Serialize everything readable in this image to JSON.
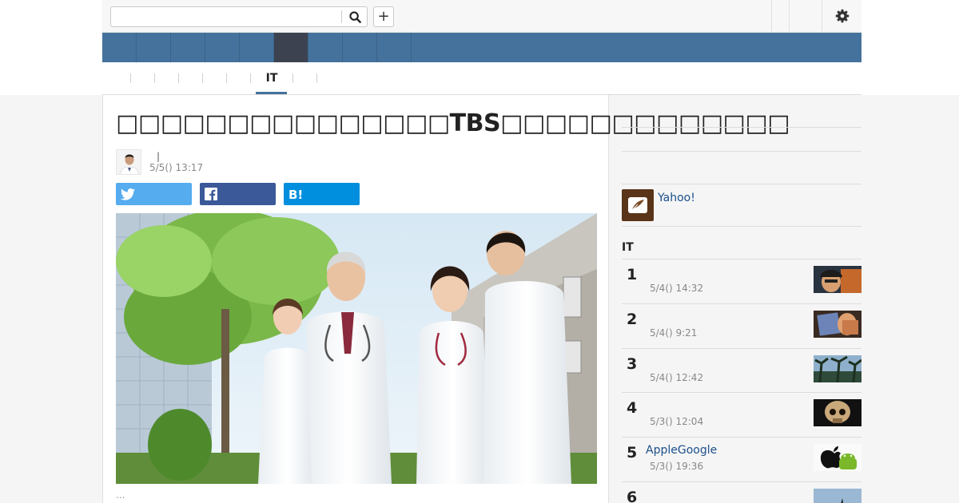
{
  "search": {
    "placeholder": ""
  },
  "header": {
    "add_label": "+"
  },
  "subnav": {
    "active_label": "IT"
  },
  "article": {
    "title": "□□□□□□□□□□□□□□□TBS□□□□□□□□□□□□□",
    "author_name": "",
    "author_sep": "|",
    "date": "5/5() 13:17",
    "share": {
      "twitter_label": "",
      "facebook_label": "",
      "hatena_label": ""
    },
    "more": "..."
  },
  "sidebar": {
    "promo_text": "Yahoo!",
    "ranking_heading": "IT",
    "ranking": [
      {
        "rank": "1",
        "title": "",
        "date": "5/4() 14:32"
      },
      {
        "rank": "2",
        "title": "",
        "date": "5/4() 9:21"
      },
      {
        "rank": "3",
        "title": "",
        "date": "5/4() 12:42"
      },
      {
        "rank": "4",
        "title": "",
        "date": "5/3() 12:04"
      },
      {
        "rank": "5",
        "title": "AppleGoogle",
        "date": "5/3() 19:36"
      },
      {
        "rank": "6",
        "title": "",
        "date": ""
      }
    ]
  },
  "colors": {
    "nav_bar": "#44729c",
    "nav_active": "#3c4250",
    "link": "#1b4f8a",
    "twitter": "#55acee",
    "facebook": "#3b5998",
    "hatena": "#008fde"
  }
}
